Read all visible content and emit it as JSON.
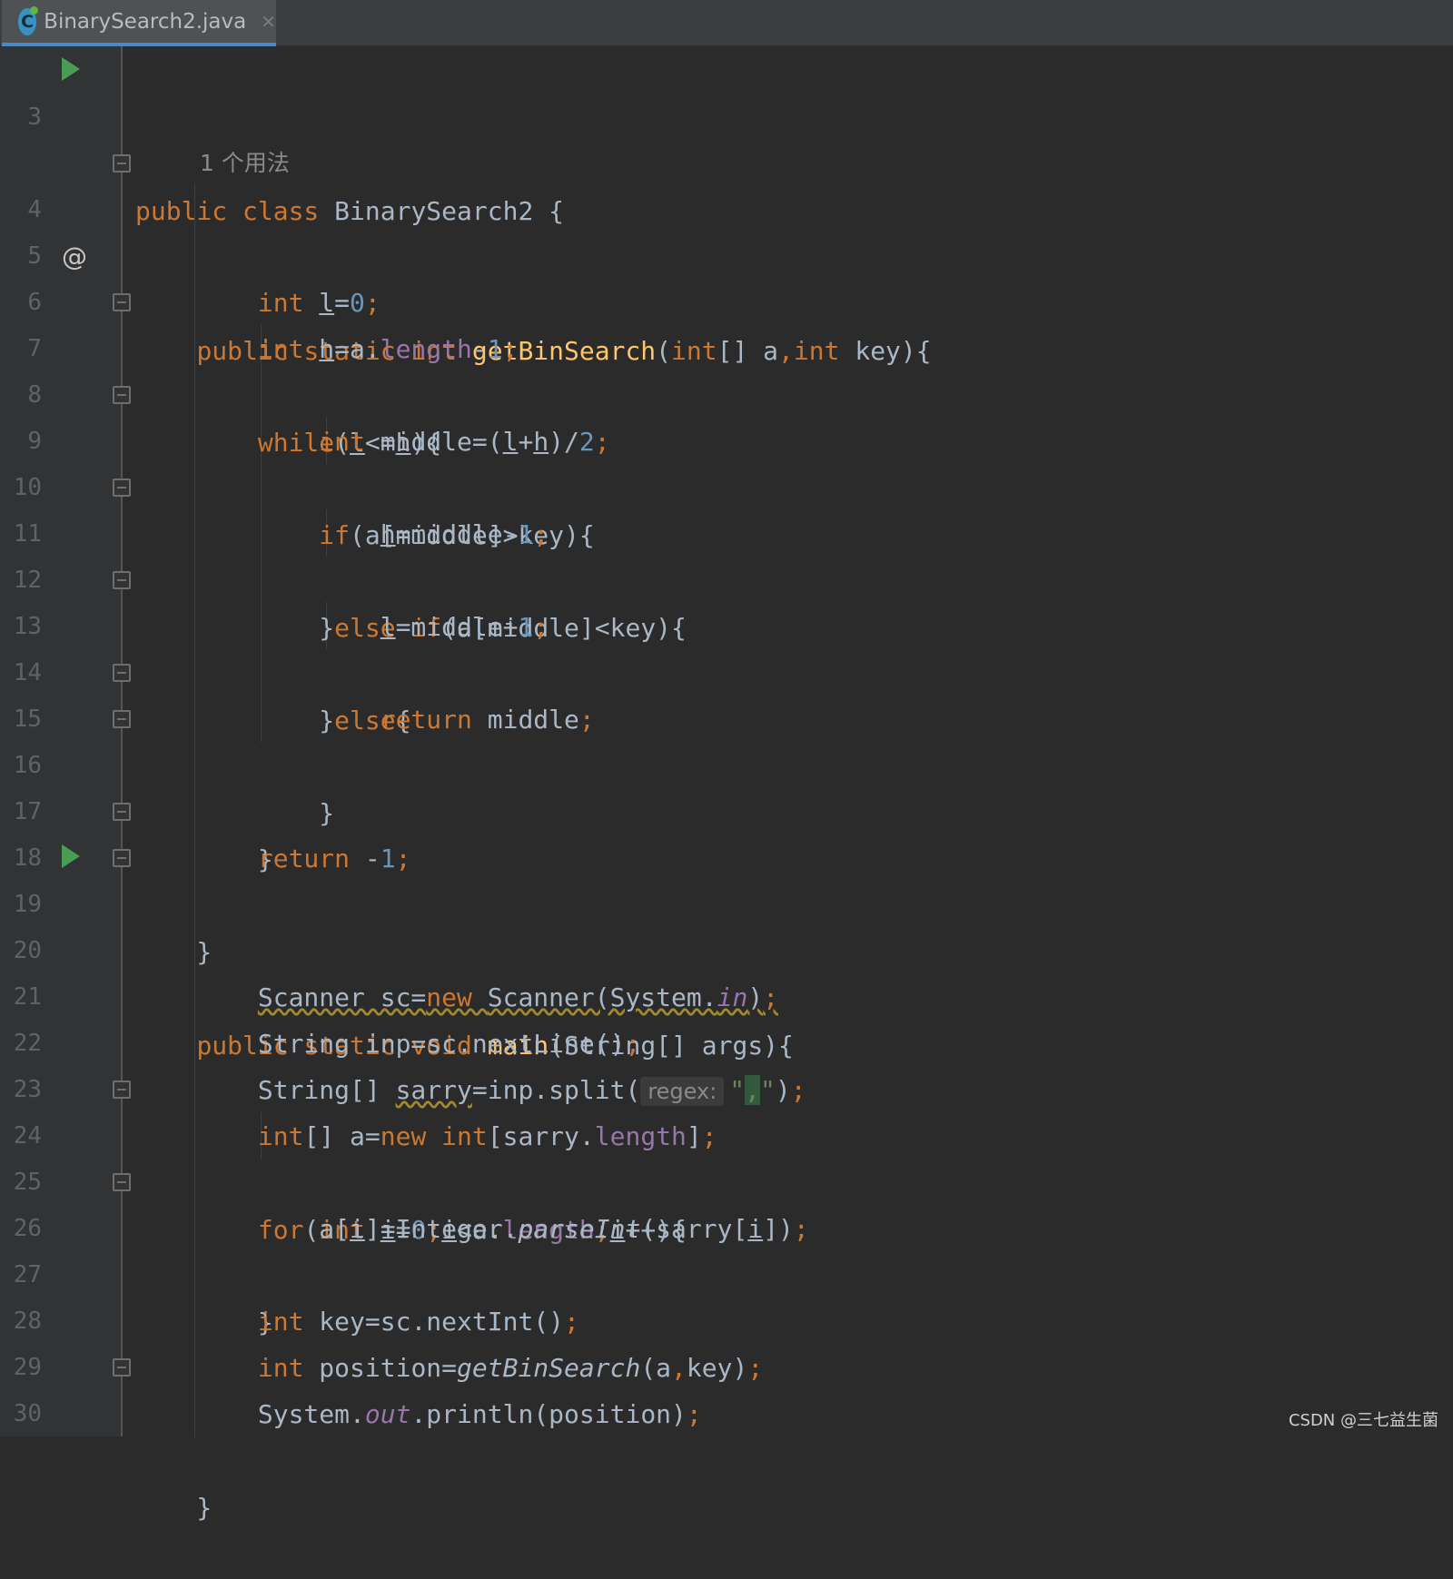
{
  "tab": {
    "file_name": "BinarySearch2.java",
    "icon": "java-class-icon",
    "icon_letter": "C",
    "close_glyph": "✕"
  },
  "inlay": {
    "usages_hint": "1 个用法",
    "regex_param": "regex:"
  },
  "watermark": "CSDN @三七益生菌",
  "line_numbers": [
    "3",
    "4",
    "5",
    "6",
    "7",
    "8",
    "9",
    "10",
    "11",
    "12",
    "13",
    "14",
    "15",
    "16",
    "17",
    "18",
    "19",
    "20",
    "21",
    "22",
    "23",
    "24",
    "25",
    "26",
    "27",
    "28",
    "29",
    "30"
  ],
  "code_lines": [
    "public class BinarySearch2 {",
    "    public static int getBinSearch(int[] a,int key){",
    "        int l=0;",
    "        int h=a.length-1;",
    "        while(l<=h){",
    "            int middle=(l+h)/2;",
    "            if(a[middle]>key){",
    "                h=middle-1;",
    "            }else if(a[middle]<key){",
    "                l=middle+1;",
    "            }else{",
    "                return middle;",
    "            }",
    "        }",
    "        return -1;",
    "    }",
    "    public static void main(String[] args){",
    "        Scanner sc=new Scanner(System.in);",
    "        String inp=sc.nextLine();",
    "        String[] sarry=inp.split(\",\");",
    "        int[] a=new int[sarry.length];",
    "        for(int i=0;i<a.length;i++){",
    "            a[i]=Integer.parseInt(sarry[i]);",
    "        }",
    "        int key=sc.nextInt();",
    "        int position=getBinSearch(a,key);",
    "        System.out.println(position);",
    "    }"
  ],
  "colors": {
    "background": "#2b2b2b",
    "gutter": "#313335",
    "keyword": "#cc7832",
    "number": "#6897bb",
    "method": "#ffc66d",
    "field": "#9876aa",
    "plain": "#a9b7c6",
    "run_icon": "#499c54"
  }
}
